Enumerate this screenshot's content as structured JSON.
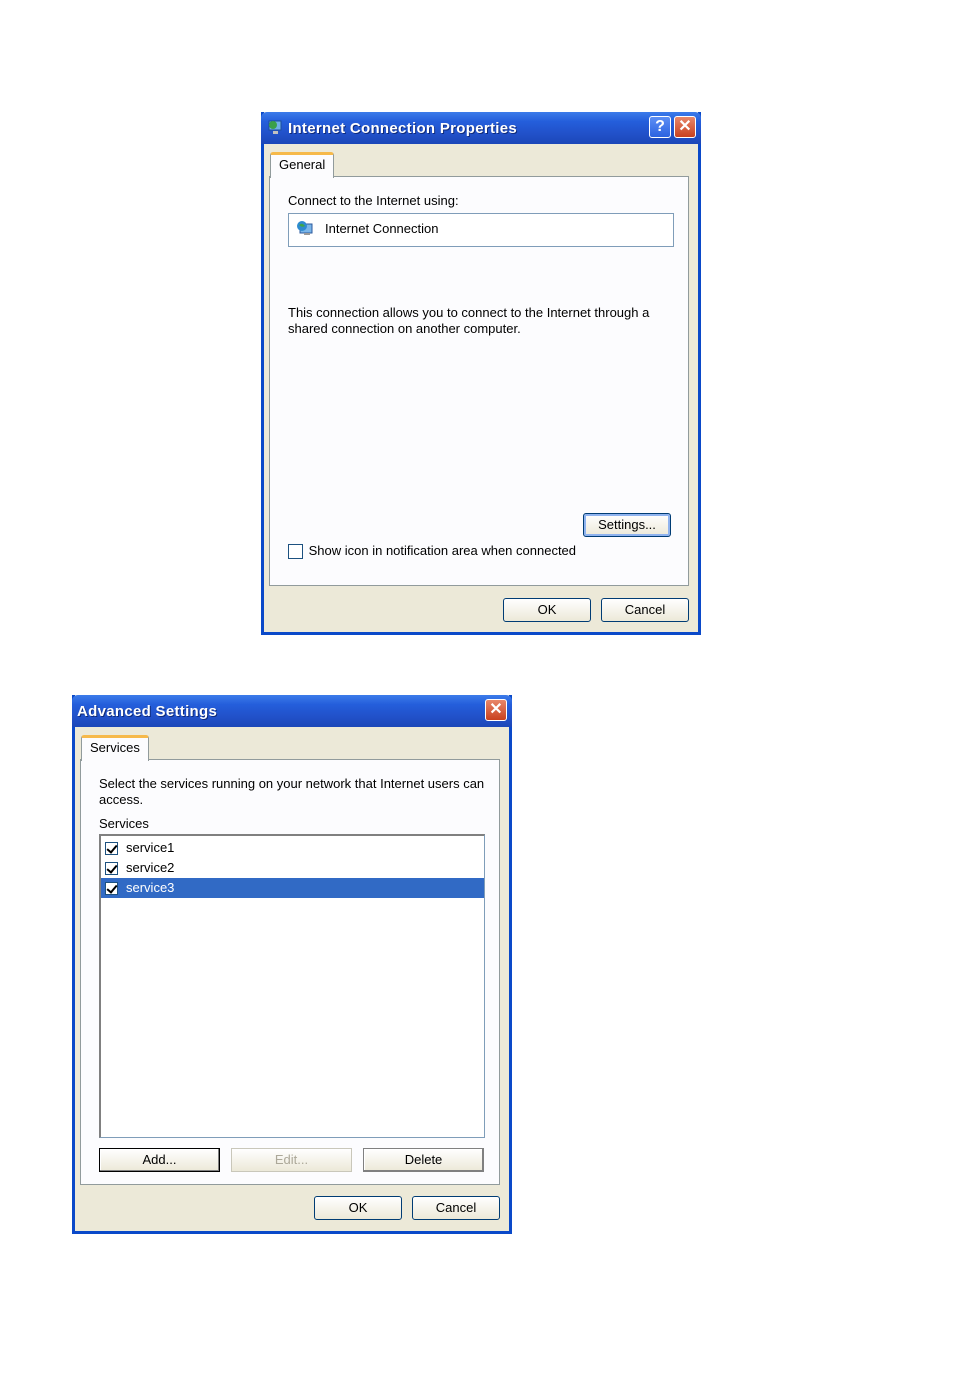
{
  "dialog1": {
    "title": "Internet Connection Properties",
    "help_label": "?",
    "close_label": "✕",
    "tab": "General",
    "connect_label": "Connect to the Internet using:",
    "connection_name": "Internet Connection",
    "description": "This connection allows you to connect to the Internet through a shared connection on another computer.",
    "settings_button": "Settings...",
    "show_icon_checkbox": {
      "label": "Show icon in notification area when connected",
      "checked": false
    },
    "ok_button": "OK",
    "cancel_button": "Cancel"
  },
  "dialog2": {
    "title": "Advanced Settings",
    "close_label": "✕",
    "tab": "Services",
    "description": "Select the services running on your network that Internet users can access.",
    "services_label": "Services",
    "services": [
      {
        "label": "service1",
        "checked": true,
        "selected": false
      },
      {
        "label": "service2",
        "checked": true,
        "selected": false
      },
      {
        "label": "service3",
        "checked": true,
        "selected": true
      }
    ],
    "add_button": "Add...",
    "edit_button": "Edit...",
    "delete_button": "Delete",
    "ok_button": "OK",
    "cancel_button": "Cancel"
  },
  "colors": {
    "titlebar": "#245edb",
    "selection": "#316ac5",
    "tab_highlight": "#f6b94a",
    "dialog_bg": "#ece9d8"
  }
}
